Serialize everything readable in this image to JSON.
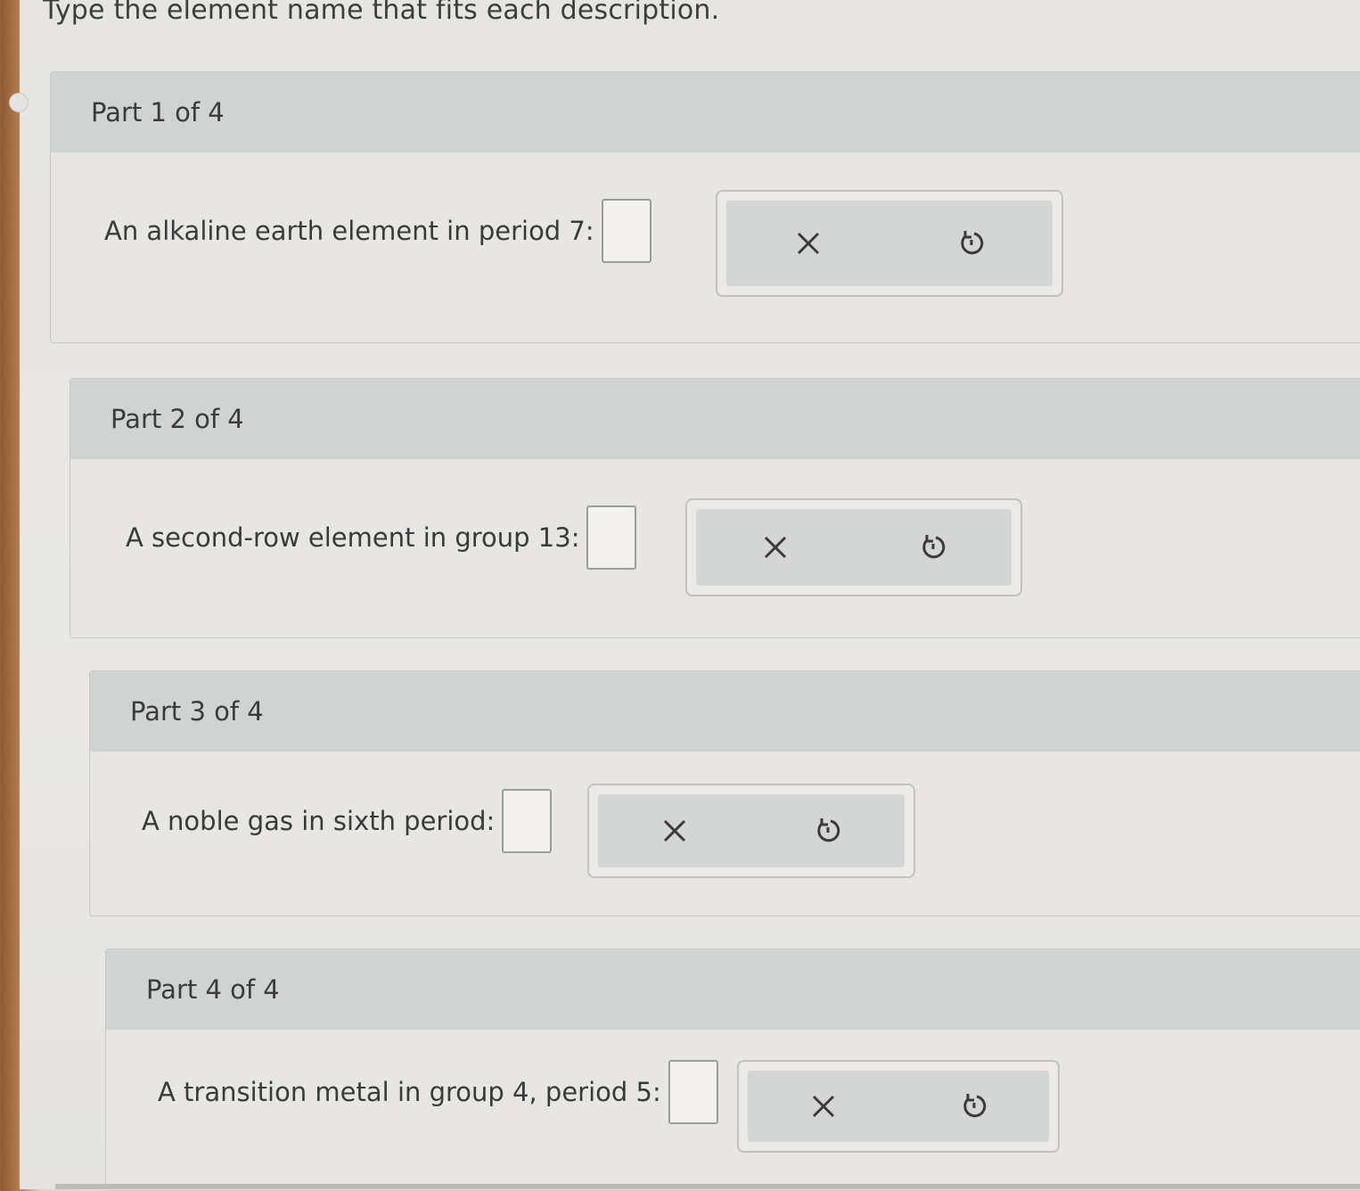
{
  "instruction": "Type the element name that fits each description.",
  "parts": [
    {
      "title": "Part 1 of 4",
      "prompt": "An alkaline earth element in period 7:",
      "answer": "",
      "clear_icon": "close-icon",
      "reset_icon": "undo-icon"
    },
    {
      "title": "Part 2 of 4",
      "prompt": "A second-row element in group 13:",
      "answer": "",
      "clear_icon": "close-icon",
      "reset_icon": "undo-icon"
    },
    {
      "title": "Part 3 of 4",
      "prompt": "A noble gas in sixth period:",
      "answer": "",
      "clear_icon": "close-icon",
      "reset_icon": "undo-icon"
    },
    {
      "title": "Part 4 of 4",
      "prompt": "A transition metal in group 4, period 5:",
      "answer": "",
      "clear_icon": "close-icon",
      "reset_icon": "undo-icon"
    }
  ],
  "colors": {
    "header_bg": "#cfd4d2",
    "button_bg": "#d3d6d4",
    "icon": "#3a3a3a"
  }
}
